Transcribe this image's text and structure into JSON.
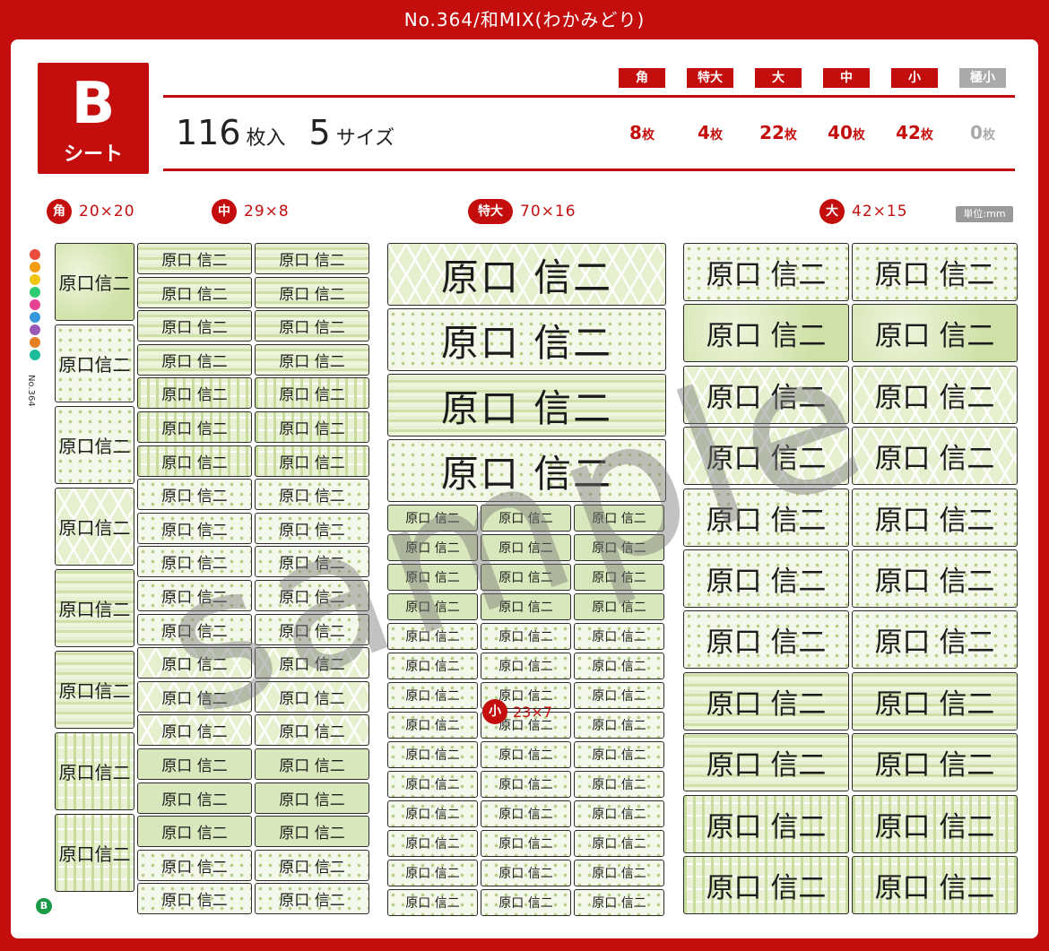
{
  "header": {
    "title": "No.364/和MIX(わかみどり)"
  },
  "sheet": {
    "letter": "B",
    "word": "シート"
  },
  "summary": {
    "count": "116",
    "count_unit": "枚入",
    "sizes": "5",
    "sizes_unit": "サイズ"
  },
  "size_table": [
    {
      "tag": "角",
      "count": "8",
      "unit": "枚",
      "enabled": true
    },
    {
      "tag": "特大",
      "count": "4",
      "unit": "枚",
      "enabled": true
    },
    {
      "tag": "大",
      "count": "22",
      "unit": "枚",
      "enabled": true
    },
    {
      "tag": "中",
      "count": "40",
      "unit": "枚",
      "enabled": true
    },
    {
      "tag": "小",
      "count": "42",
      "unit": "枚",
      "enabled": true
    },
    {
      "tag": "極小",
      "count": "0",
      "unit": "枚",
      "enabled": false
    }
  ],
  "sections": {
    "kaku": {
      "tag": "角",
      "dims": "20×20"
    },
    "chu": {
      "tag": "中",
      "dims": "29×8"
    },
    "tokudai": {
      "tag": "特大",
      "dims": "70×16"
    },
    "dai": {
      "tag": "大",
      "dims": "42×15"
    },
    "sho": {
      "tag": "小",
      "dims": "23×7"
    }
  },
  "unit_note": "単位:mm",
  "label_name": "原口 信二",
  "label_name_kaku": "原口信二",
  "watermark": "sample",
  "side_logo": {
    "text": "No.364"
  },
  "corner_mark": "B",
  "colors": {
    "brand_red": "#c40e0e",
    "label_green": "#d9e8bc",
    "disabled_gray": "#aaaaaa"
  }
}
